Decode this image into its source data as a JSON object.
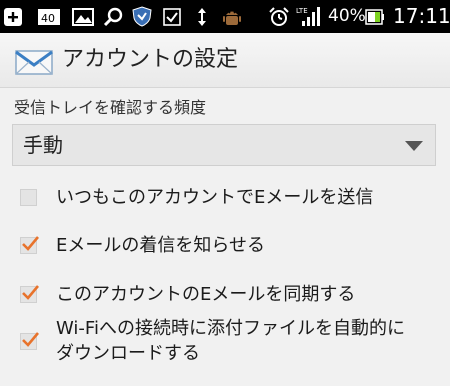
{
  "status_bar": {
    "battery_percent": "40%",
    "time": "17:11",
    "network_label": "LTE"
  },
  "action_bar": {
    "title": "アカウントの設定",
    "icon": "mail-envelope-icon"
  },
  "sync_frequency": {
    "label": "受信トレイを確認する頻度",
    "selected": "手動"
  },
  "options": [
    {
      "label": "いつもこのアカウントでEメールを送信",
      "checked": false
    },
    {
      "label": "Eメールの着信を知らせる",
      "checked": true
    },
    {
      "label": "このアカウントのEメールを同期する",
      "checked": true
    },
    {
      "label": "Wi-Fiへの接続時に添付ファイルを自動的に",
      "label2": "ダウンロードする",
      "checked": true
    }
  ],
  "colors": {
    "check_mark": "#e8732c",
    "background": "#f1f1f1"
  }
}
